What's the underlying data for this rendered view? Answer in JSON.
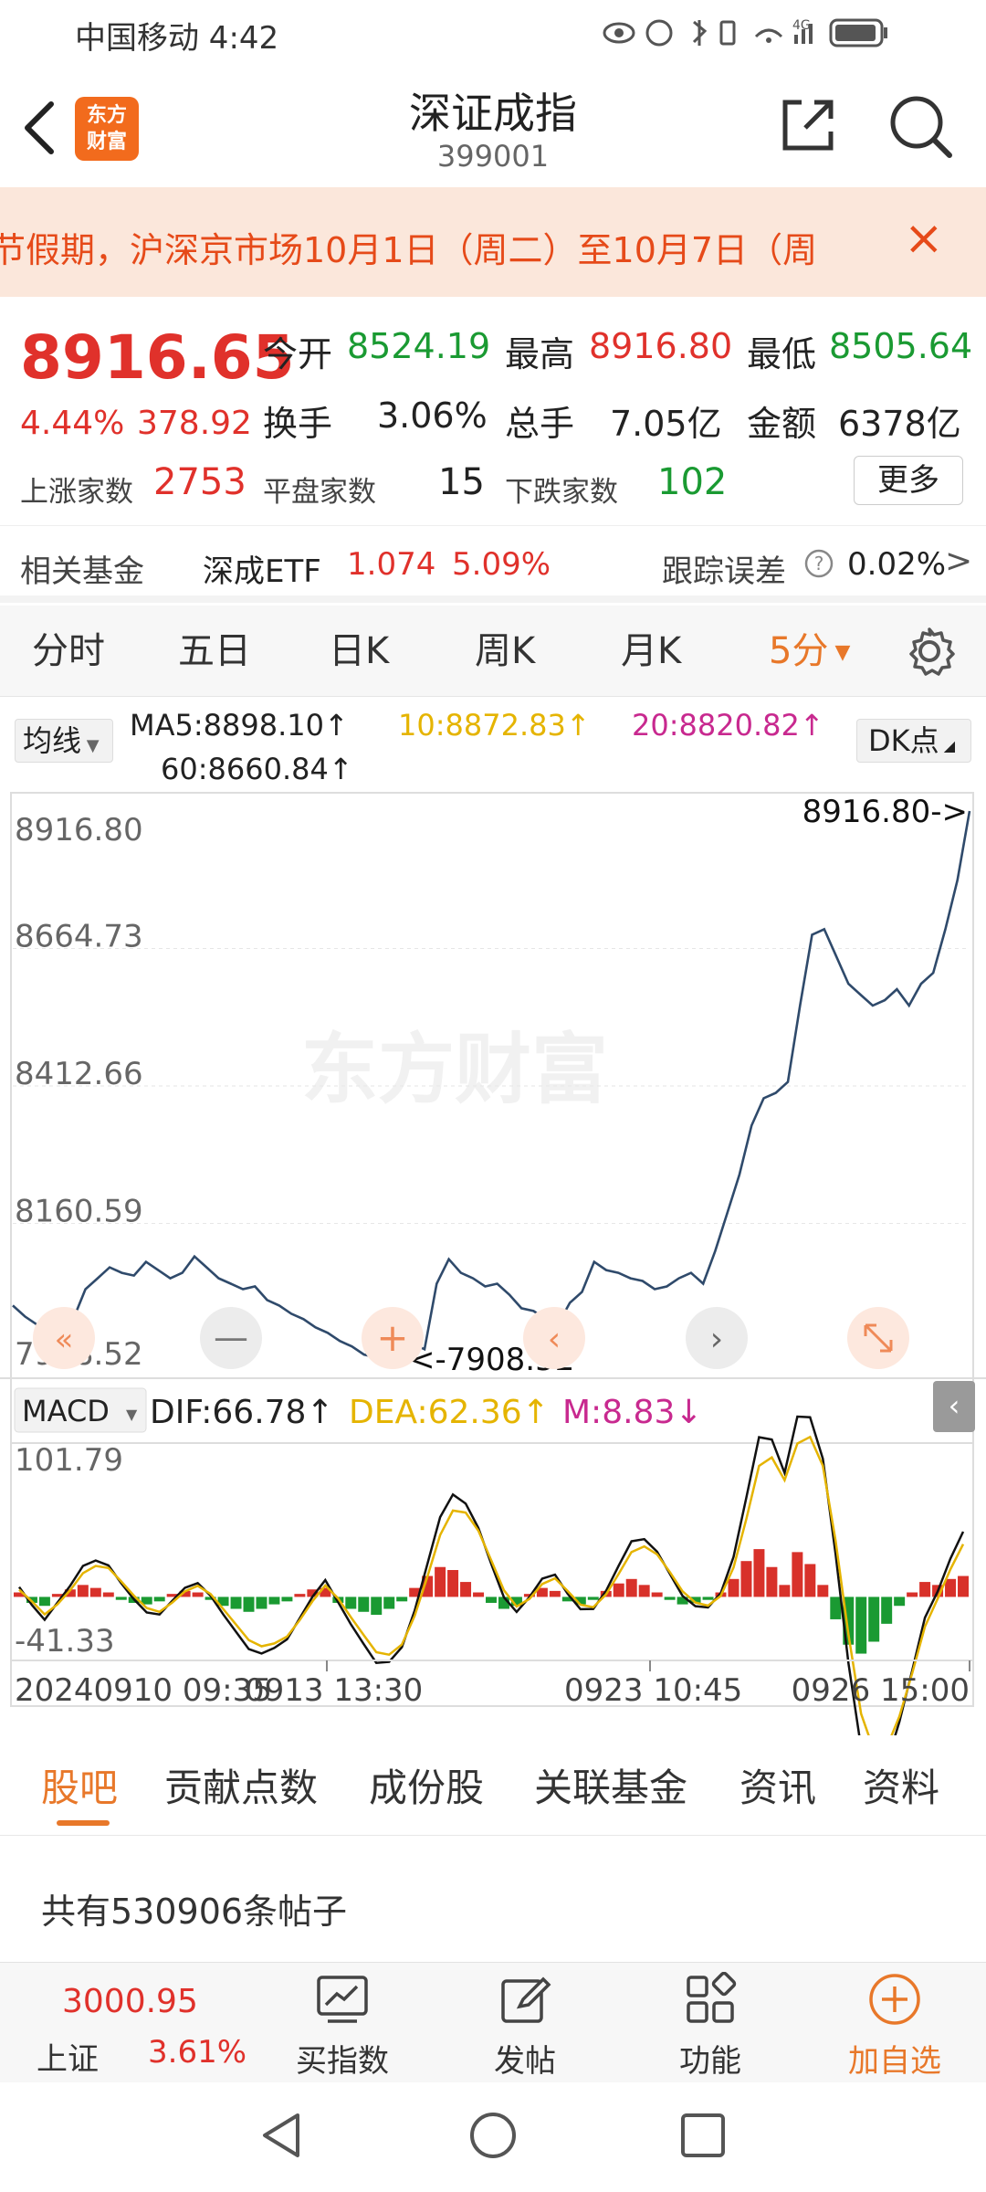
{
  "status_bar": {
    "carrier_time": "中国移动 4:42",
    "network": "4G",
    "battery": "battery"
  },
  "nav": {
    "title": "深证成指",
    "code": "399001",
    "logo_text_1": "东方",
    "logo_text_2": "财富"
  },
  "notice": {
    "text": "节假期，沪深京市场10月1日（周二）至10月7日（周",
    "close": "×"
  },
  "quote": {
    "price": "8916.65",
    "change_pct": "4.44%",
    "change_amt": "378.92",
    "open_label": "今开",
    "open": "8524.19",
    "high_label": "最高",
    "high": "8916.80",
    "low_label": "最低",
    "low": "8505.64",
    "turnover_rate_label": "换手",
    "turnover_rate": "3.06%",
    "volume_label": "总手",
    "volume": "7.05亿",
    "amount_label": "金额",
    "amount": "6378亿",
    "up_label": "上涨家数",
    "up": "2753",
    "flat_label": "平盘家数",
    "flat": "15",
    "down_label": "下跌家数",
    "down": "102",
    "more": "更多"
  },
  "fund": {
    "label": "相关基金",
    "name": "深成ETF",
    "price": "1.074",
    "pct": "5.09%",
    "err_label": "跟踪误差",
    "err": "0.02%"
  },
  "period_tabs": [
    "分时",
    "五日",
    "日K",
    "周K",
    "月K",
    "5分"
  ],
  "ma": {
    "selector": "均线",
    "ma5": "MA5:8898.10↑",
    "ma10": "10:8872.83↑",
    "ma20": "20:8820.82↑",
    "ma60": "60:8660.84↑",
    "dk": "DK点"
  },
  "colors": {
    "red": "#e0312b",
    "green": "#1a9a32",
    "orange": "#e8782a",
    "ma10": "#e5b400",
    "ma20": "#c8298f",
    "line": "#2f4a6b"
  },
  "chart_data": {
    "type": "line",
    "y_ticks": [
      "8916.80",
      "8664.73",
      "8412.66",
      "8160.59",
      "7908.52"
    ],
    "ylim": [
      7908.52,
      8916.8
    ],
    "x_ticks": [
      "20240910 09:35",
      "0913 13:30",
      "0923 10:45",
      "0926 15:00"
    ],
    "high_marker": "8916.80->",
    "low_marker": "<-7908.52",
    "series": [
      {
        "name": "",
        "values": [
          8010,
          7990,
          7975,
          7960,
          7950,
          7985,
          8040,
          8060,
          8080,
          8070,
          8065,
          8090,
          8075,
          8060,
          8070,
          8100,
          8080,
          8060,
          8050,
          8040,
          8045,
          8020,
          8010,
          7995,
          7985,
          7970,
          7960,
          7945,
          7935,
          7920,
          7915,
          7930,
          7918,
          7940,
          7930,
          8050,
          8095,
          8070,
          8060,
          8045,
          8050,
          8030,
          8005,
          8000,
          7985,
          7975,
          8015,
          8035,
          8090,
          8075,
          8070,
          8060,
          8055,
          8040,
          8045,
          8060,
          8070,
          8050,
          8110,
          8180,
          8250,
          8340,
          8390,
          8400,
          8420,
          8560,
          8690,
          8700,
          8650,
          8600,
          8580,
          8560,
          8570,
          8590,
          8560,
          8600,
          8620,
          8700,
          8790,
          8916.8
        ]
      }
    ]
  },
  "macd": {
    "selector": "MACD",
    "dif": "DIF:66.78↑",
    "dea": "DEA:62.36↑",
    "m": "M:8.83↓",
    "y_ticks": [
      "101.79",
      "-41.33"
    ],
    "ylim": [
      -41.33,
      101.79
    ],
    "bars": [
      3,
      -4,
      -6,
      2,
      5,
      8,
      6,
      3,
      -2,
      -4,
      -5,
      -3,
      2,
      4,
      3,
      -2,
      -6,
      -8,
      -10,
      -8,
      -5,
      -3,
      2,
      5,
      6,
      -4,
      -8,
      -10,
      -12,
      -8,
      -3,
      6,
      14,
      20,
      18,
      10,
      3,
      -4,
      -8,
      -6,
      2,
      6,
      4,
      -3,
      -5,
      -2,
      4,
      9,
      12,
      8,
      3,
      -2,
      -5,
      -4,
      -2,
      3,
      12,
      24,
      32,
      20,
      8,
      30,
      22,
      8,
      -15,
      -32,
      -38,
      -30,
      -18,
      -6,
      3,
      10,
      8,
      12,
      14
    ]
  },
  "bottom_tabs": [
    "股吧",
    "贡献点数",
    "成份股",
    "关联基金",
    "资讯",
    "资料"
  ],
  "posts": {
    "count_text": "共有530906条帖子"
  },
  "bottom_bar": {
    "index_value": "3000.95",
    "index_name": "上证",
    "index_pct": "3.61%",
    "buy": "买指数",
    "post": "发帖",
    "func": "功能",
    "add": "加自选"
  }
}
